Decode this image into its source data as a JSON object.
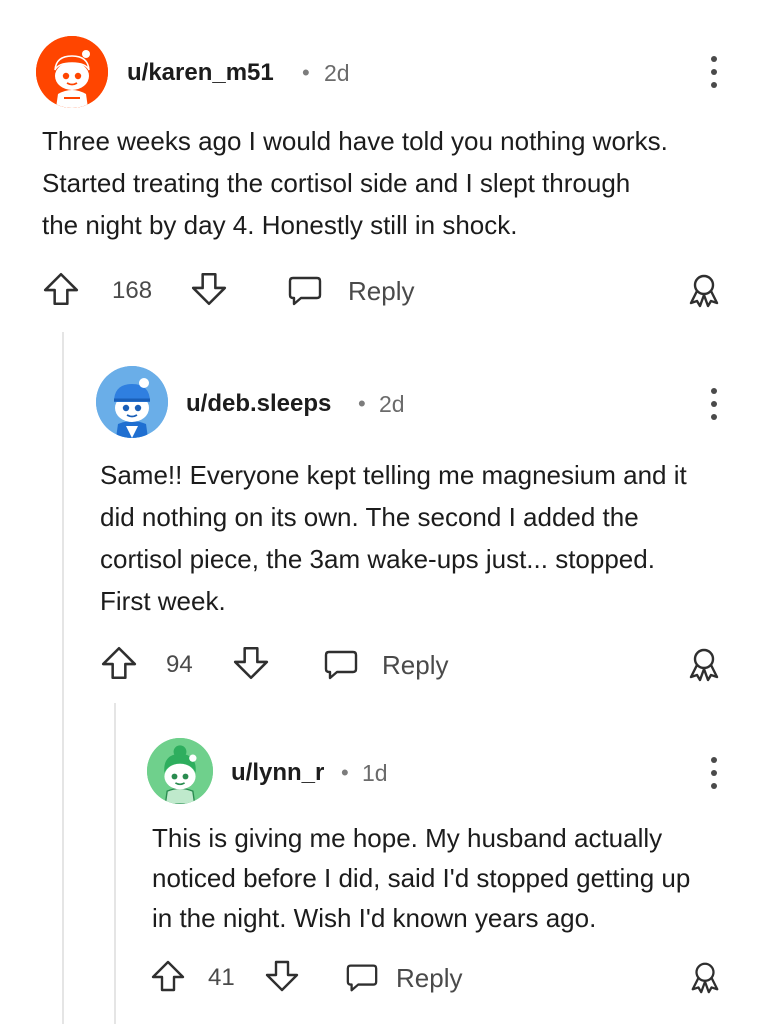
{
  "comments": [
    {
      "username": "u/karen_m51",
      "separator": "•",
      "time": "2d",
      "lines": [
        "Three weeks ago I would have told you nothing works.",
        "Started treating the cortisol side and I slept through",
        "the night by day 4. Honestly still in shock."
      ],
      "votes": "168",
      "reply_label": "Reply",
      "avatar_color": "#ff4500"
    },
    {
      "username": "u/deb.sleeps",
      "separator": "•",
      "time": "2d",
      "lines": [
        "Same!! Everyone kept telling me magnesium and it",
        "did nothing on its own. The second I added the",
        "cortisol piece, the 3am wake-ups just... stopped.",
        "First week."
      ],
      "votes": "94",
      "reply_label": "Reply",
      "avatar_color": "#6aaee8"
    },
    {
      "username": "u/lynn_r",
      "separator": "•",
      "time": "1d",
      "lines": [
        "This is giving me hope. My husband actually",
        "noticed before I did, said I'd stopped getting up",
        "in the night. Wish I'd known years ago."
      ],
      "votes": "41",
      "reply_label": "Reply",
      "avatar_color": "#6fd08c"
    }
  ]
}
